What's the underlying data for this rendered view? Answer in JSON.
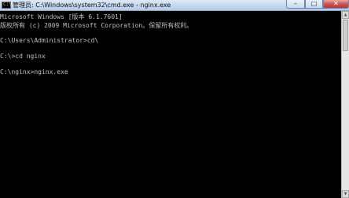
{
  "window": {
    "title": "管理员: C:\\Windows\\system32\\cmd.exe - nginx.exe",
    "icon_text": "C:\\",
    "icon_name": "cmd-icon",
    "controls": {
      "minimize": "–",
      "maximize": "□",
      "close": "✕"
    }
  },
  "console": {
    "lines": [
      "Microsoft Windows [版本 6.1.7601]",
      "版权所有 (c) 2009 Microsoft Corporation。保留所有权利。",
      "",
      "C:\\Users\\Administrator>cd\\",
      "",
      "C:\\>cd nginx",
      "",
      "C:\\nginx>nginx.exe"
    ]
  },
  "scrollbar": {
    "up_glyph": "▲",
    "down_glyph": "▼"
  },
  "colors": {
    "console_background": "#000000",
    "console_text": "#c0c0c0",
    "titlebar": "#c4d8ee",
    "close_button": "#c75050"
  }
}
